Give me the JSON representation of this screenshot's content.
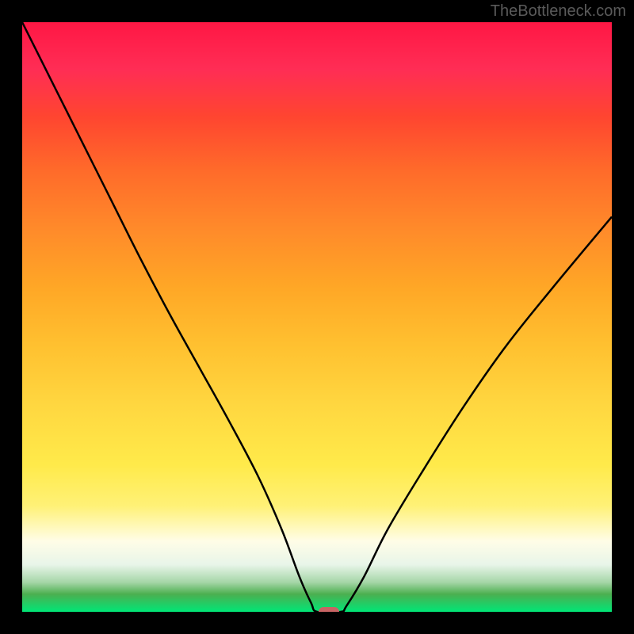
{
  "watermark": "TheBottleneck.com",
  "chart_data": {
    "type": "line",
    "title": "",
    "xlabel": "",
    "ylabel": "",
    "xlim": [
      0,
      100
    ],
    "ylim": [
      0,
      100
    ],
    "minimum_x": 52,
    "curve_points": [
      {
        "x": 0,
        "y": 100
      },
      {
        "x": 5,
        "y": 90
      },
      {
        "x": 10,
        "y": 80
      },
      {
        "x": 15,
        "y": 70
      },
      {
        "x": 20,
        "y": 60
      },
      {
        "x": 25,
        "y": 50.5
      },
      {
        "x": 30,
        "y": 41.5
      },
      {
        "x": 35,
        "y": 32.5
      },
      {
        "x": 40,
        "y": 23
      },
      {
        "x": 44,
        "y": 14
      },
      {
        "x": 47,
        "y": 6
      },
      {
        "x": 49,
        "y": 1.5
      },
      {
        "x": 50,
        "y": 0
      },
      {
        "x": 54,
        "y": 0
      },
      {
        "x": 55,
        "y": 1
      },
      {
        "x": 58,
        "y": 6
      },
      {
        "x": 62,
        "y": 14
      },
      {
        "x": 68,
        "y": 24
      },
      {
        "x": 75,
        "y": 35
      },
      {
        "x": 82,
        "y": 45
      },
      {
        "x": 90,
        "y": 55
      },
      {
        "x": 100,
        "y": 67
      }
    ],
    "marker": {
      "x": 52,
      "y": 0,
      "width_pct": 3.5,
      "height_pct": 1.5,
      "color": "#c86464"
    }
  }
}
